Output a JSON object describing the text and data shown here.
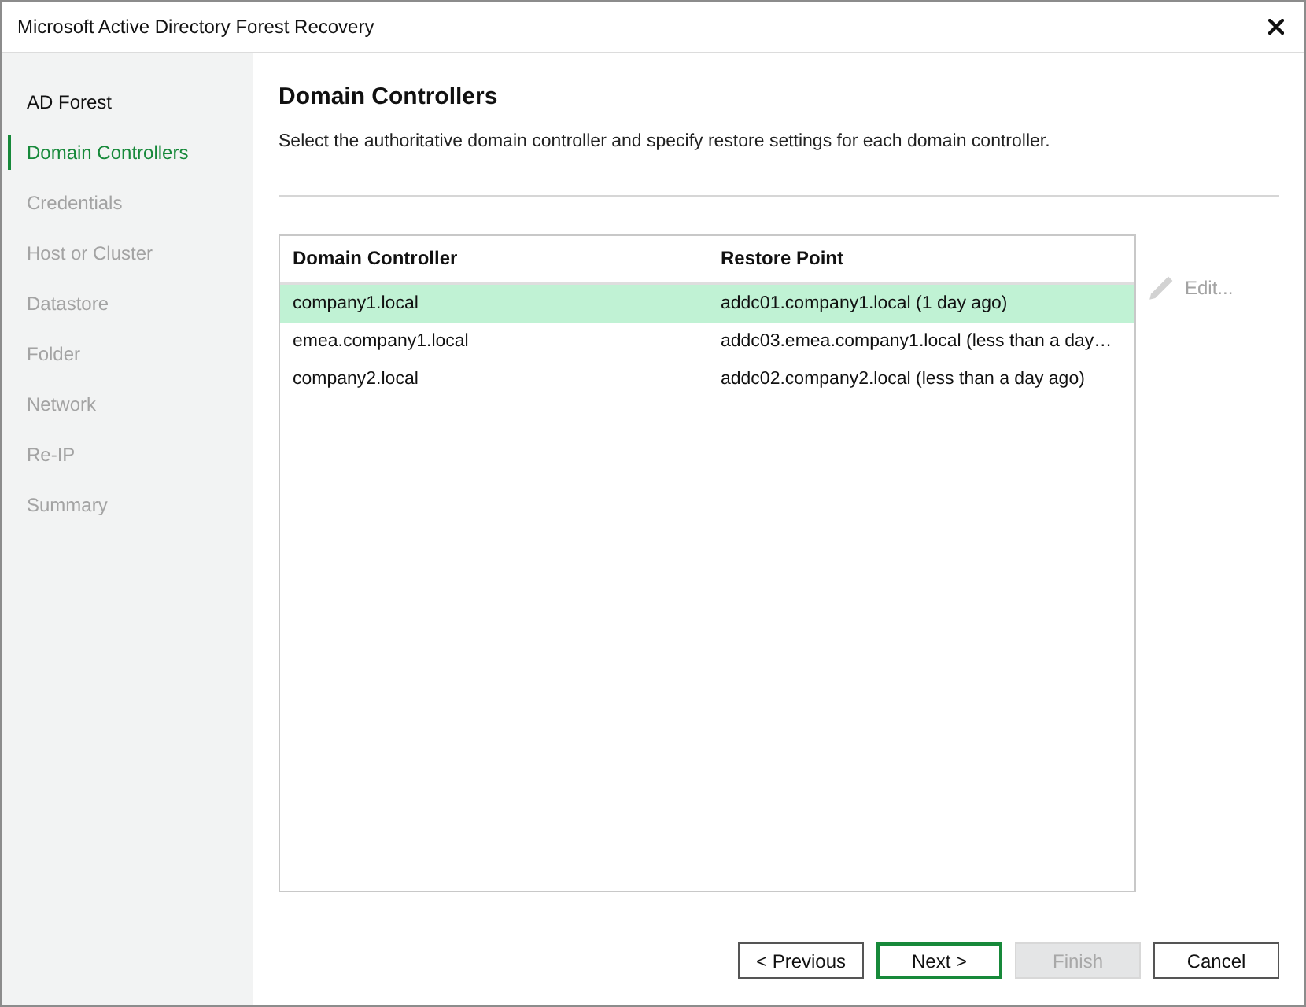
{
  "window": {
    "title": "Microsoft Active Directory Forest Recovery"
  },
  "steps": [
    {
      "label": "AD Forest",
      "selected": false,
      "disabled": false
    },
    {
      "label": "Domain Controllers",
      "selected": true,
      "disabled": false
    },
    {
      "label": "Credentials",
      "selected": false,
      "disabled": true
    },
    {
      "label": "Host or Cluster",
      "selected": false,
      "disabled": true
    },
    {
      "label": "Datastore",
      "selected": false,
      "disabled": true
    },
    {
      "label": "Folder",
      "selected": false,
      "disabled": true
    },
    {
      "label": "Network",
      "selected": false,
      "disabled": true
    },
    {
      "label": "Re-IP",
      "selected": false,
      "disabled": true
    },
    {
      "label": "Summary",
      "selected": false,
      "disabled": true
    }
  ],
  "page": {
    "title": "Domain Controllers",
    "description": "Select the authoritative domain controller and specify restore settings for each domain controller."
  },
  "table": {
    "columns": [
      "Domain Controller",
      "Restore Point"
    ],
    "rows": [
      {
        "cells": [
          "company1.local",
          "addc01.company1.local (1 day ago)"
        ],
        "selected": true
      },
      {
        "cells": [
          "emea.company1.local",
          "addc03.emea.company1.local (less than a day…"
        ],
        "selected": false
      },
      {
        "cells": [
          "company2.local",
          "addc02.company2.local (less than a day ago)"
        ],
        "selected": false
      }
    ]
  },
  "edit_button": {
    "label": "Edit...",
    "disabled": true
  },
  "buttons": [
    {
      "label": "< Previous",
      "default": false,
      "disabled": false
    },
    {
      "label": "Next >",
      "default": true,
      "disabled": false
    },
    {
      "label": "Finish",
      "default": false,
      "disabled": true
    },
    {
      "label": "Cancel",
      "default": false,
      "disabled": false
    }
  ]
}
